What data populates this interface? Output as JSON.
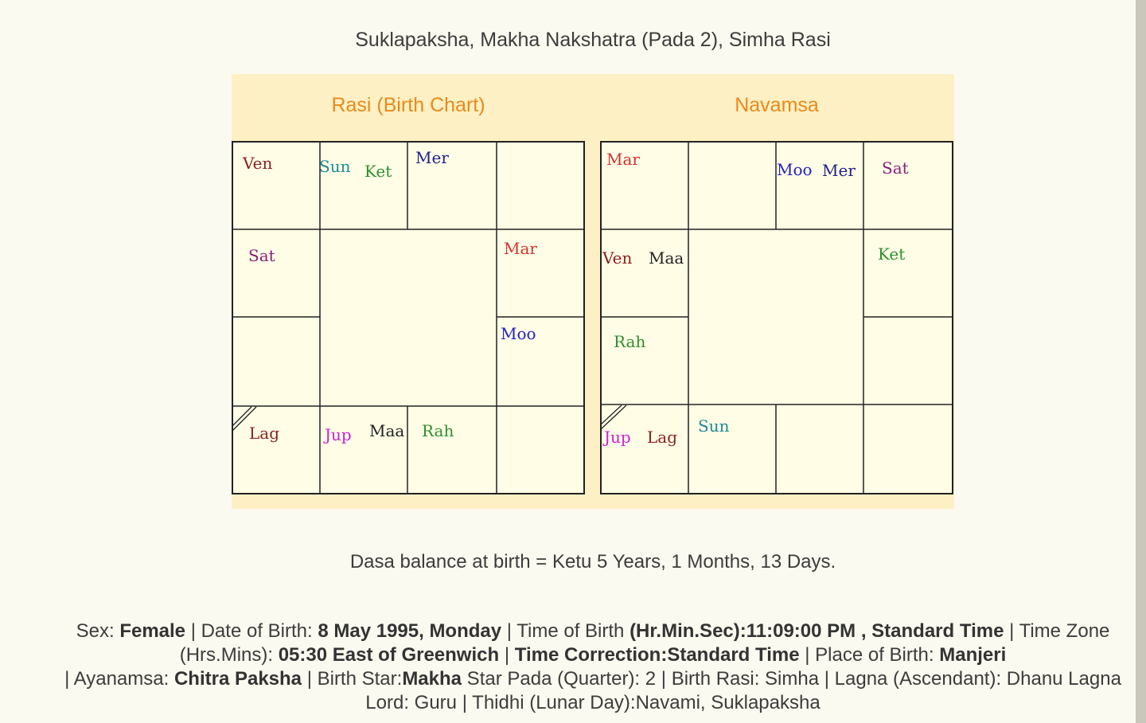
{
  "header": {
    "subtitle": "Suklapaksha, Makha Nakshatra (Pada 2), Simha Rasi"
  },
  "charts": {
    "rasi": {
      "title": "Rasi (Birth Chart)",
      "labels": {
        "ven": "Ven",
        "sun": "Sun",
        "ket": "Ket",
        "mer": "Mer",
        "sat": "Sat",
        "mar": "Mar",
        "moo": "Moo",
        "lag": "Lag",
        "jup": "Jup",
        "maa": "Maa",
        "rah": "Rah"
      }
    },
    "navamsa": {
      "title": "Navamsa",
      "labels": {
        "mar": "Mar",
        "moo": "Moo",
        "mer": "Mer",
        "sat": "Sat",
        "ven": "Ven",
        "maa": "Maa",
        "ket": "Ket",
        "rah": "Rah",
        "jup": "Jup",
        "lag": "Lag",
        "sun": "Sun"
      }
    }
  },
  "planet_colors": {
    "ven": "#8b2020",
    "sun": "#1d8a94",
    "ket": "#2f8f2f",
    "mer": "#1f1f8a",
    "sat": "#8a1f7a",
    "mar": "#d83030",
    "moo": "#2323c0",
    "lag": "#8a2020",
    "jup": "#d020d0",
    "maa": "#222222",
    "rah": "#2f8f2f"
  },
  "dasa": {
    "text": "Dasa balance at birth = Ketu 5 Years, 1 Months, 13 Days."
  },
  "details": {
    "sex_label": "Sex: ",
    "sex": "Female",
    "dob_label": " | Date of Birth: ",
    "dob": "8 May 1995, Monday",
    "tob_label": " | Time of Birth ",
    "tob": "(Hr.Min.Sec):11:09:00 PM , Standard Time",
    "tz_label": " | Time Zone (Hrs.Mins): ",
    "tz": "05:30 East of Greenwich",
    "sep1": " | ",
    "time_correction": "Time Correction:Standard Time",
    "pob_label": " | Place of Birth: ",
    "pob": "Manjeri",
    "ayanamsa_label": " | Ayanamsa: ",
    "ayanamsa": "Chitra Paksha",
    "star_label": " | Birth Star:",
    "star": "Makha",
    "rest": " Star Pada (Quarter): 2 | Birth Rasi: Simha | Lagna (Ascendant): Dhanu Lagna Lord: Guru | Thidhi (Lunar Day):Navami, Suklapaksha"
  }
}
